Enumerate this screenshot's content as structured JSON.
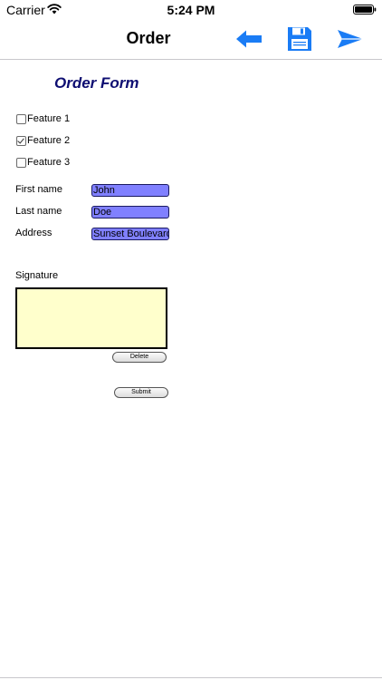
{
  "status_bar": {
    "carrier": "Carrier",
    "time": "5:24 PM"
  },
  "nav_bar": {
    "title": "Order",
    "icons": [
      "arrow-left-icon",
      "floppy-disk-icon",
      "paper-plane-icon"
    ],
    "accent_color": "#1a7cf5"
  },
  "form": {
    "heading": "Order Form",
    "heading_color": "#0e0e72",
    "features": [
      {
        "label": "Feature 1",
        "checked": false
      },
      {
        "label": "Feature 2",
        "checked": true
      },
      {
        "label": "Feature 3",
        "checked": false
      }
    ],
    "fields": {
      "first_name": {
        "label": "First name",
        "value": "John"
      },
      "last_name": {
        "label": "Last name",
        "value": "Doe"
      },
      "address": {
        "label": "Address",
        "value": "Sunset Boulevard"
      }
    },
    "field_color": "#8080ff",
    "signature": {
      "label": "Signature",
      "pad_color": "#ffffcc",
      "delete_label": "Delete"
    },
    "submit_label": "Submit"
  }
}
